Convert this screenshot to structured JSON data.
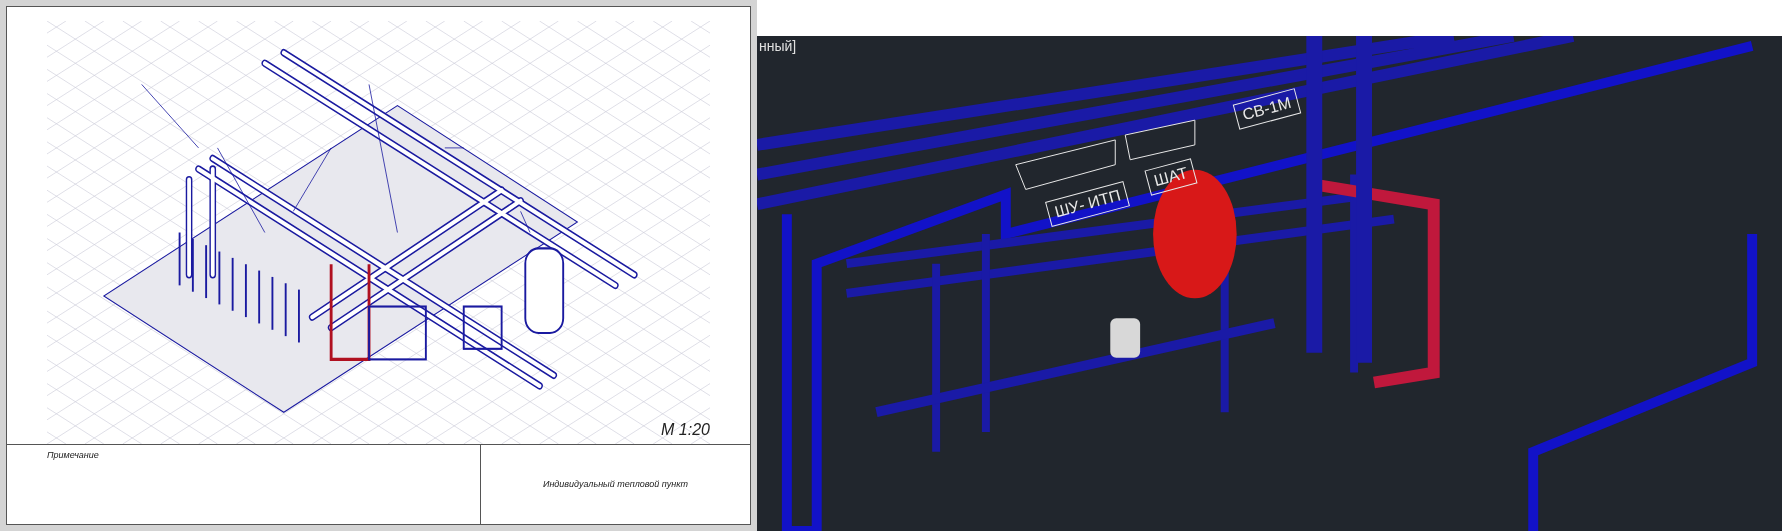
{
  "drawing_sheet": {
    "scale": "М 1:20",
    "notes_title": "Примечание",
    "title_block": {
      "title": "Индивидуальный тепловой пункт"
    }
  },
  "viewport": {
    "view_label": "нный]",
    "labels": [
      {
        "text": "ШУ- ИТП"
      },
      {
        "text": "ШАТ"
      },
      {
        "text": "СВ-1М"
      }
    ]
  }
}
